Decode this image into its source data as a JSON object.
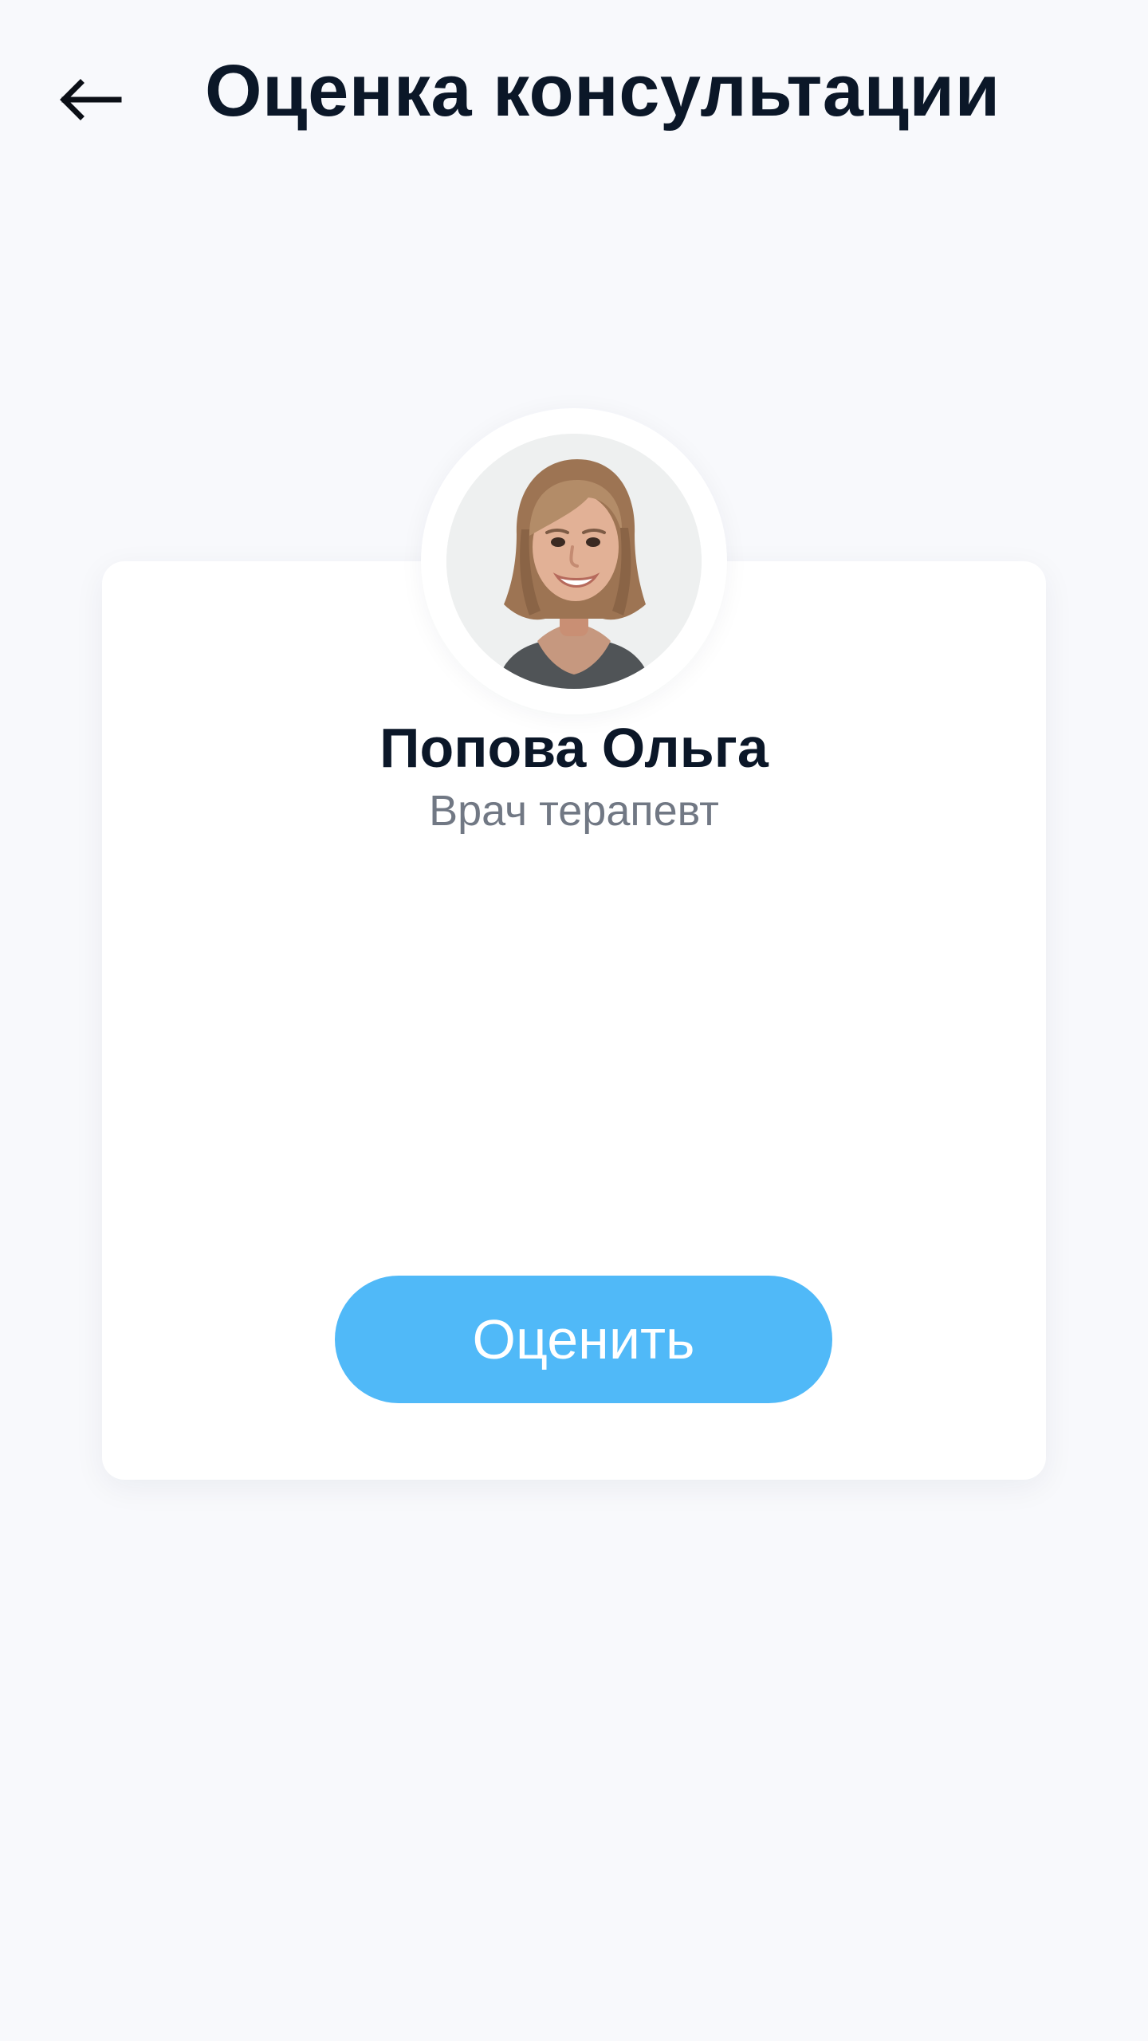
{
  "header": {
    "back_icon": "arrow-left-icon",
    "title": "Оценка консультации"
  },
  "doctor": {
    "avatar_icon": "doctor-photo",
    "name": "Попова Ольга",
    "role": "Врач терапевт"
  },
  "actions": {
    "rate_label": "Оценить"
  },
  "colors": {
    "background": "#f8f9fc",
    "card": "#ffffff",
    "title": "#0b1728",
    "subtitle": "#717884",
    "accent": "#50b9f8"
  }
}
